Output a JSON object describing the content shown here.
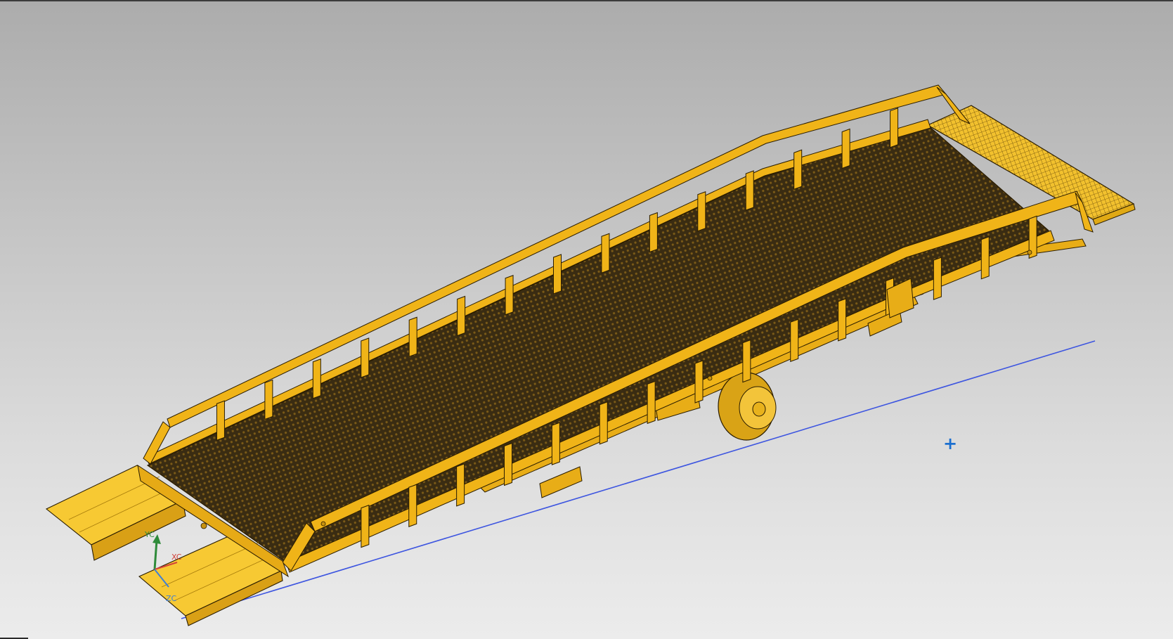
{
  "viewport": {
    "background_top": "#acacac",
    "background_bottom": "#ececec"
  },
  "model": {
    "body_color": "#f0b418",
    "edge_color": "#2a1c00",
    "deck_color": "#3a2c12",
    "ramp_plate_color": "#f7c933",
    "grating_color": "#f2c12e",
    "wheel_color": "#e8b21c"
  },
  "triad": {
    "y_label": "YC",
    "x_label": "XC",
    "z_label": "ZC",
    "y_color": "#2e8b3a",
    "x_color": "#d2433b",
    "z_color": "#3f7fd6"
  },
  "guide_line": {
    "color": "#3d55e0"
  },
  "cursor": {
    "glyph": "+",
    "color": "#1b6fcf",
    "icon": "crosshair-icon"
  }
}
